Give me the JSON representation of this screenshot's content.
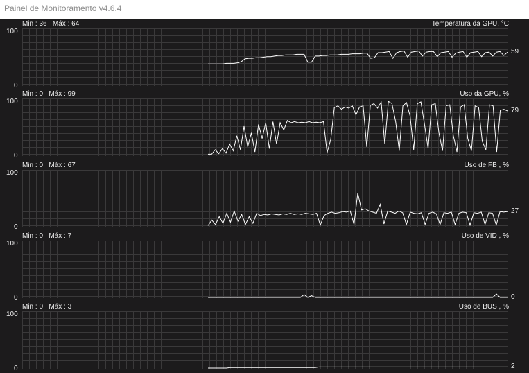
{
  "window": {
    "title": "Painel de Monitoramento v4.6.4"
  },
  "colors": {
    "background": "#1c1b1c",
    "grid": "#3a393a",
    "trace": "#ffffff",
    "text": "#ececec"
  },
  "panels": [
    {
      "metric": "Temperatura da GPU, °C",
      "min_label": "Min : 36",
      "max_label": "Máx : 64",
      "ymax_label": "100",
      "ymin_label": "0",
      "current": "59",
      "ylim": [
        0,
        100
      ],
      "trace": [
        38,
        38,
        38,
        38,
        38,
        39,
        39,
        39,
        40,
        42,
        47,
        48,
        48,
        49,
        49,
        50,
        51,
        51,
        52,
        53,
        53,
        54,
        54,
        54,
        55,
        55,
        55,
        41,
        41,
        52,
        52,
        53,
        53,
        54,
        54,
        54,
        55,
        55,
        55,
        56,
        56,
        56,
        57,
        57,
        48,
        49,
        58,
        58,
        59,
        60,
        48,
        58,
        60,
        61,
        50,
        59,
        60,
        61,
        52,
        59,
        60,
        60,
        51,
        58,
        59,
        60,
        50,
        57,
        59,
        60,
        50,
        58,
        59,
        60,
        51,
        58,
        59,
        52,
        59,
        60,
        53,
        59
      ]
    },
    {
      "metric": "Uso da GPU, %",
      "min_label": "Min : 0",
      "max_label": "Máx : 99",
      "ymax_label": "100",
      "ymin_label": "0",
      "current": "79",
      "ylim": [
        0,
        100
      ],
      "trace": [
        2,
        2,
        10,
        3,
        12,
        4,
        20,
        8,
        35,
        10,
        52,
        15,
        40,
        6,
        55,
        30,
        58,
        12,
        60,
        20,
        58,
        45,
        62,
        58,
        60,
        58,
        59,
        58,
        60,
        58,
        59,
        58,
        60,
        5,
        28,
        85,
        88,
        82,
        86,
        84,
        88,
        72,
        86,
        88,
        15,
        89,
        92,
        84,
        95,
        20,
        96,
        92,
        60,
        8,
        88,
        94,
        70,
        10,
        92,
        95,
        55,
        12,
        90,
        92,
        40,
        8,
        88,
        90,
        35,
        6,
        86,
        90,
        30,
        8,
        88,
        85,
        25,
        10,
        90,
        88,
        6,
        80,
        82,
        79
      ]
    },
    {
      "metric": "Uso de FB , %",
      "min_label": "Min : 0",
      "max_label": "Máx : 67",
      "ymax_label": "100",
      "ymin_label": "0",
      "current": "27",
      "ylim": [
        0,
        100
      ],
      "trace": [
        2,
        12,
        4,
        18,
        6,
        24,
        8,
        28,
        10,
        22,
        4,
        18,
        6,
        24,
        20,
        22,
        21,
        23,
        22,
        21,
        23,
        22,
        24,
        22,
        23,
        22,
        24,
        23,
        22,
        24,
        3,
        20,
        24,
        26,
        24,
        25,
        27,
        26,
        28,
        4,
        60,
        30,
        32,
        28,
        26,
        24,
        40,
        5,
        28,
        26,
        24,
        28,
        25,
        4,
        26,
        24,
        23,
        25,
        4,
        24,
        26,
        23,
        4,
        25,
        24,
        26,
        4,
        24,
        26,
        25,
        3,
        25,
        24,
        26,
        4,
        25,
        24,
        3,
        27,
        26,
        27
      ]
    },
    {
      "metric": "Uso de VID , %",
      "min_label": "Min : 0",
      "max_label": "Máx : 7",
      "ymax_label": "100",
      "ymin_label": "0",
      "current": "0",
      "ylim": [
        0,
        100
      ],
      "trace": [
        0,
        0,
        0,
        0,
        0,
        0,
        0,
        0,
        0,
        0,
        0,
        0,
        0,
        0,
        0,
        0,
        0,
        0,
        0,
        0,
        0,
        0,
        0,
        0,
        0,
        0,
        5,
        0,
        3,
        0,
        0,
        0,
        0,
        0,
        0,
        0,
        0,
        0,
        0,
        0,
        0,
        0,
        0,
        0,
        0,
        0,
        0,
        0,
        0,
        0,
        0,
        0,
        0,
        0,
        0,
        0,
        0,
        0,
        0,
        0,
        0,
        0,
        0,
        0,
        0,
        0,
        0,
        0,
        0,
        0,
        0,
        0,
        0,
        0,
        0,
        0,
        0,
        0,
        6,
        0,
        0,
        0
      ]
    },
    {
      "metric": "Uso de BUS , %",
      "min_label": "Min : 0",
      "max_label": "Máx : 3",
      "ymax_label": "100",
      "ymin_label": "0",
      "current": "2",
      "ylim": [
        0,
        100
      ],
      "trace": [
        0,
        0,
        0,
        0,
        0,
        0,
        1,
        1,
        1,
        1,
        1,
        1,
        1,
        1,
        1,
        1,
        1,
        1,
        1,
        1,
        1,
        1,
        1,
        1,
        1,
        1,
        1,
        1,
        1,
        1,
        2,
        2,
        2,
        2,
        2,
        2,
        2,
        2,
        2,
        2,
        2,
        2,
        2,
        2,
        2,
        2,
        2,
        2,
        2,
        2,
        2,
        2,
        2,
        2,
        2,
        2,
        2,
        2,
        2,
        2,
        2,
        2,
        2,
        2,
        2,
        2,
        2,
        2,
        2,
        2,
        2,
        2,
        2,
        2,
        2,
        2,
        2,
        2,
        2,
        2,
        2,
        2
      ]
    }
  ]
}
